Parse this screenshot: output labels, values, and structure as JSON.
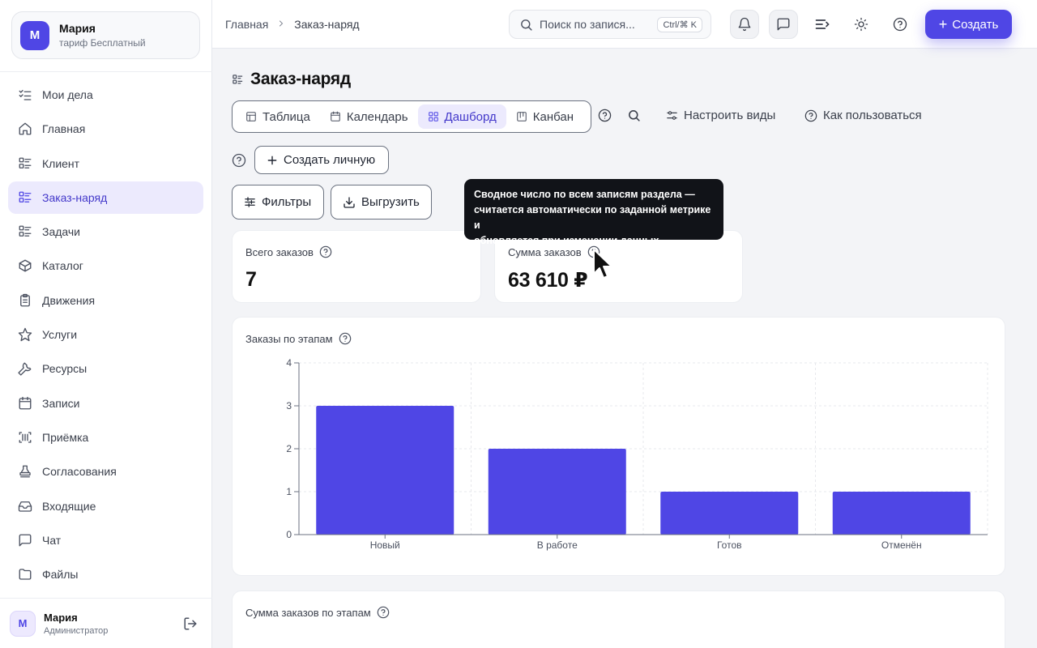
{
  "workspace": {
    "initial": "М",
    "name": "Мария",
    "plan": "тариф Бесплатный"
  },
  "sidebar": {
    "items": [
      {
        "label": "Мои дела",
        "icon": "checklist-icon"
      },
      {
        "label": "Главная",
        "icon": "home-icon"
      },
      {
        "label": "Клиент",
        "icon": "list-icon"
      },
      {
        "label": "Заказ-наряд",
        "icon": "list-icon",
        "active": true
      },
      {
        "label": "Задачи",
        "icon": "list-icon"
      },
      {
        "label": "Каталог",
        "icon": "box-icon"
      },
      {
        "label": "Движения",
        "icon": "clipboard-icon"
      },
      {
        "label": "Услуги",
        "icon": "star-icon"
      },
      {
        "label": "Ресурсы",
        "icon": "wrench-icon"
      },
      {
        "label": "Записи",
        "icon": "calendar-icon"
      },
      {
        "label": "Приёмка",
        "icon": "scan-icon"
      },
      {
        "label": "Согласования",
        "icon": "stamp-icon"
      },
      {
        "label": "Входящие",
        "icon": "inbox-icon"
      },
      {
        "label": "Чат",
        "icon": "chat-icon"
      },
      {
        "label": "Файлы",
        "icon": "folder-icon"
      }
    ]
  },
  "user": {
    "initial": "М",
    "name": "Мария",
    "role": "Администратор"
  },
  "topbar": {
    "breadcrumb": [
      "Главная",
      "Заказ-наряд"
    ],
    "search_placeholder": "Поиск по запися...",
    "search_shortcut": "Ctrl/⌘ K",
    "create_label": "Создать"
  },
  "page": {
    "title": "Заказ-наряд",
    "views": [
      {
        "label": "Таблица",
        "icon": "table-icon"
      },
      {
        "label": "Календарь",
        "icon": "calendar-icon"
      },
      {
        "label": "Дашборд",
        "icon": "dashboard-icon",
        "active": true
      },
      {
        "label": "Канбан",
        "icon": "kanban-icon"
      }
    ],
    "configure_views": "Настроить виды",
    "how_to_use": "Как пользоваться",
    "create_personal": "Создать личную",
    "filters": "Фильтры",
    "export": "Выгрузить"
  },
  "stats": {
    "total_orders": {
      "label": "Всего заказов",
      "value": "7"
    },
    "sum_orders": {
      "label": "Сумма заказов",
      "value": "63 610 ₽"
    }
  },
  "tooltip": {
    "text_line1": "Сводное число по всем записям раздела —",
    "text_line2": "считается автоматически по заданной метрике и",
    "text_line3": "обновляется при изменении данных."
  },
  "chart_section": {
    "title": "Заказы по этапам"
  },
  "second_section": {
    "title": "Сумма заказов по этапам"
  },
  "accent_color": "#4f46e5",
  "chart_data": {
    "type": "bar",
    "title": "Заказы по этапам",
    "categories": [
      "Новый",
      "В работе",
      "Готов",
      "Отменён"
    ],
    "values": [
      3,
      2,
      1,
      1
    ],
    "ylim": [
      0,
      4
    ],
    "yticks": [
      0,
      1,
      2,
      3,
      4
    ],
    "grid": true,
    "color": "#4f46e5"
  }
}
